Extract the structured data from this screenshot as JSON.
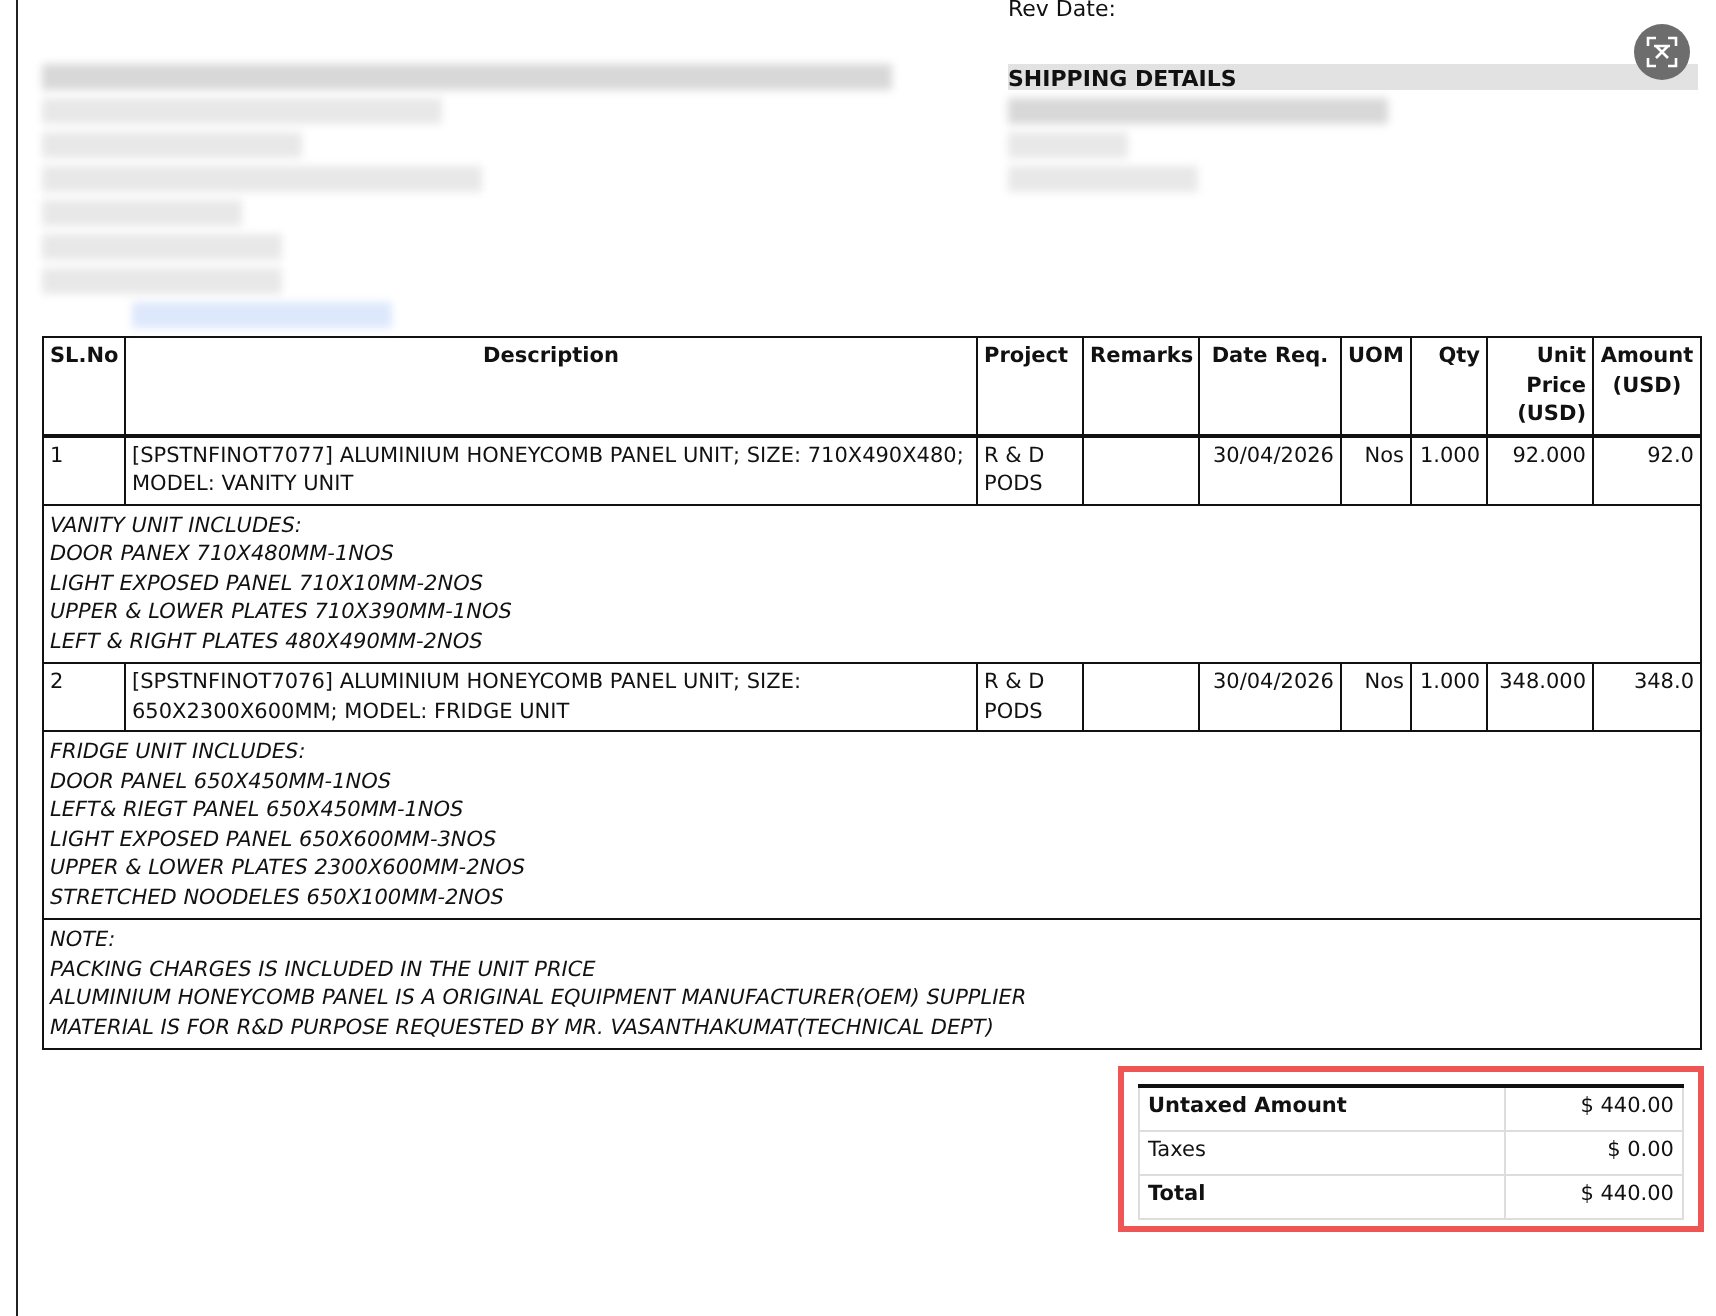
{
  "header": {
    "rev_date_label": "Rev Date:",
    "shipping_heading": "SHIPPING DETAILS"
  },
  "table": {
    "columns": [
      "SL.No",
      "Description",
      "Project",
      "Remarks",
      "Date Req.",
      "UOM",
      "Qty",
      "Unit Price (USD)",
      "Amount (USD)"
    ],
    "rows": [
      {
        "kind": "item",
        "sl": "1",
        "description": "[SPSTNFINOT7077] ALUMINIUM HONEYCOMB PANEL UNIT; SIZE: 710X490X480; MODEL: VANITY UNIT",
        "project": "R & D PODS",
        "date": "30/04/2026",
        "uom": "Nos",
        "qty": "1.000",
        "unit_price": "92.000",
        "amount": "92.0"
      },
      {
        "kind": "note",
        "lines": [
          "VANITY UNIT INCLUDES:",
          "DOOR PANEX 710X480MM-1NOS",
          "LIGHT EXPOSED PANEL 710X10MM-2NOS",
          "UPPER & LOWER PLATES 710X390MM-1NOS",
          "LEFT & RIGHT PLATES 480X490MM-2NOS"
        ]
      },
      {
        "kind": "item",
        "sl": "2",
        "description": "[SPSTNFINOT7076] ALUMINIUM HONEYCOMB PANEL UNIT; SIZE: 650X2300X600MM; MODEL: FRIDGE UNIT",
        "project": "R & D PODS",
        "date": "30/04/2026",
        "uom": "Nos",
        "qty": "1.000",
        "unit_price": "348.000",
        "amount": "348.0"
      },
      {
        "kind": "note",
        "lines": [
          "FRIDGE UNIT INCLUDES:",
          "DOOR PANEL 650X450MM-1NOS",
          "LEFT& RIEGT PANEL 650X450MM-1NOS",
          "LIGHT EXPOSED PANEL 650X600MM-3NOS",
          "UPPER & LOWER PLATES 2300X600MM-2NOS",
          "STRETCHED NOODELES 650X100MM-2NOS"
        ]
      },
      {
        "kind": "note",
        "lines": [
          "NOTE:",
          "PACKING CHARGES IS INCLUDED IN THE UNIT PRICE",
          "ALUMINIUM HONEYCOMB PANEL IS A ORIGINAL EQUIPMENT MANUFACTURER(OEM) SUPPLIER",
          "MATERIAL IS FOR R&D PURPOSE REQUESTED BY MR. VASANTHAKUMAT(TECHNICAL DEPT)"
        ]
      }
    ]
  },
  "totals": {
    "highlighted": true,
    "rows": [
      {
        "label": "Untaxed Amount",
        "value": "$ 440.00",
        "bold": true
      },
      {
        "label": "Taxes",
        "value": "$ 0.00",
        "bold": false
      },
      {
        "label": "Total",
        "value": "$ 440.00",
        "bold": true
      }
    ]
  }
}
